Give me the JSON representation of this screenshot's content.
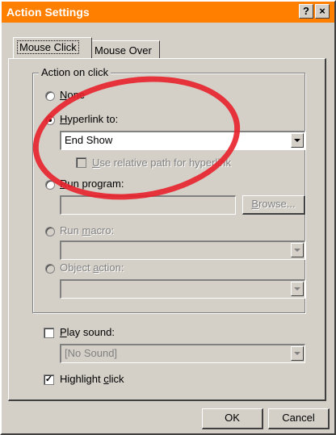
{
  "window": {
    "title": "Action Settings",
    "help_glyph": "?",
    "close_glyph": "×"
  },
  "tabs": [
    {
      "label": "Mouse Click",
      "selected": true
    },
    {
      "label": "Mouse Over",
      "selected": false
    }
  ],
  "action_group": {
    "label": "Action on click",
    "none": {
      "prefix": "",
      "mnemonic": "N",
      "rest": "one",
      "selected": false
    },
    "hyperlink": {
      "prefix": "",
      "mnemonic": "H",
      "rest": "yperlink to:",
      "selected": true,
      "value": "End Show"
    },
    "relative_path": {
      "prefix": "",
      "mnemonic": "U",
      "rest": "se relative path for hyperlink",
      "checked": false
    },
    "run_program": {
      "prefix": "",
      "mnemonic": "R",
      "rest": "un program:",
      "selected": false,
      "value": ""
    },
    "browse_button": {
      "prefix": "",
      "mnemonic": "B",
      "rest": "rowse..."
    },
    "run_macro": {
      "prefix": "Run ",
      "mnemonic": "m",
      "rest": "acro:",
      "selected": false,
      "value": ""
    },
    "object_action": {
      "prefix": "Object ",
      "mnemonic": "a",
      "rest": "ction:",
      "selected": false,
      "value": ""
    }
  },
  "play_sound": {
    "prefix": "",
    "mnemonic": "P",
    "rest": "lay sound:",
    "checked": false,
    "value": "[No Sound]"
  },
  "highlight_click": {
    "prefix": "Highlight ",
    "mnemonic": "c",
    "rest": "lick",
    "checked": true,
    "check_glyph": "✓"
  },
  "buttons": {
    "ok": "OK",
    "cancel": "Cancel"
  },
  "colors": {
    "title_bar": "#ff7f00",
    "annotation": "#e8202a",
    "face": "#d4d0c8"
  }
}
